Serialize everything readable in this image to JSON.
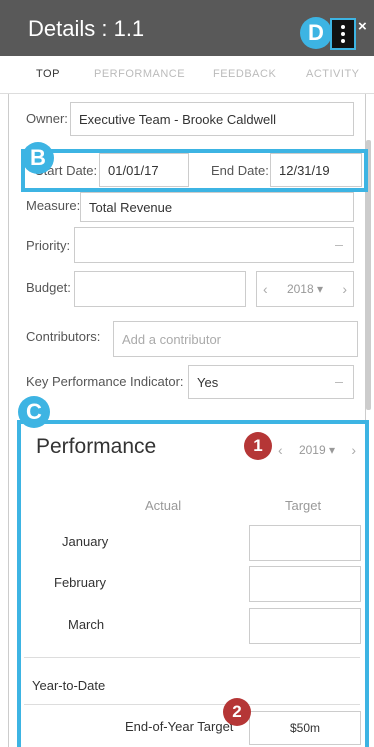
{
  "header": {
    "title": "Details : 1.1",
    "close_label": "×"
  },
  "tabs": [
    {
      "label": "TOP",
      "active": true
    },
    {
      "label": "PERFORMANCE",
      "active": false
    },
    {
      "label": "FEEDBACK",
      "active": false
    },
    {
      "label": "ACTIVITY",
      "active": false
    }
  ],
  "form": {
    "owner_label": "Owner:",
    "owner_value": "Executive Team - Brooke Caldwell",
    "start_label": "Start Date:",
    "start_value": "01/01/17",
    "end_label": "End Date:",
    "end_value": "12/31/19",
    "measure_label": "Measure:",
    "measure_value": "Total Revenue",
    "priority_label": "Priority:",
    "priority_value": "",
    "budget_label": "Budget:",
    "budget_value": "",
    "budget_year": "2018",
    "contributors_label": "Contributors:",
    "contributors_placeholder": "Add a contributor",
    "kpi_label": "Key Performance Indicator:",
    "kpi_value": "Yes"
  },
  "performance": {
    "title": "Performance",
    "year": "2019",
    "col_actual": "Actual",
    "col_target": "Target",
    "months": [
      "January",
      "February",
      "March"
    ],
    "ytd_label": "Year-to-Date",
    "eoy_label": "End-of-Year Target",
    "eoy_value": "$50m"
  },
  "callouts": {
    "b": "B",
    "c": "C",
    "d": "D",
    "one": "1",
    "two": "2"
  },
  "colors": {
    "header_bg": "#595959",
    "highlight": "#3db4e3",
    "callout_red": "#b53636"
  }
}
